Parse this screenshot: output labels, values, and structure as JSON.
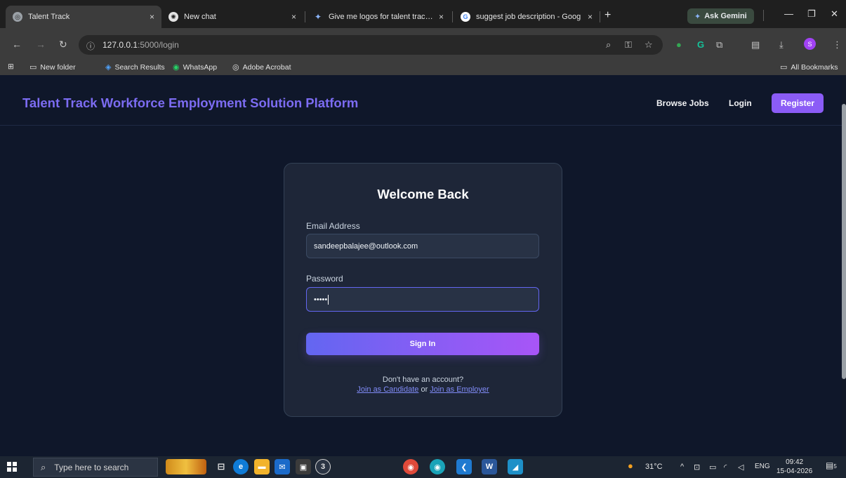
{
  "browser": {
    "tabs": [
      {
        "title": "Talent Track",
        "active": true,
        "close": "×"
      },
      {
        "title": "New chat",
        "active": false,
        "close": "×"
      },
      {
        "title": "Give me logos for talent track w",
        "active": false,
        "close": "×"
      },
      {
        "title": "suggest job description - Goog",
        "active": false,
        "close": "×"
      }
    ],
    "new_tab": "+",
    "gemini_label": "Ask Gemini",
    "window_controls": {
      "minimize": "—",
      "restore": "❐",
      "close": "✕"
    },
    "url_host": "127.0.0.1",
    "url_path": ":5000/login",
    "bookmarks": [
      {
        "label": "New folder",
        "icon": "folder-icon"
      },
      {
        "label": "Search Results",
        "icon": "search-results-icon"
      },
      {
        "label": "WhatsApp",
        "icon": "whatsapp-icon"
      },
      {
        "label": "Adobe Acrobat",
        "icon": "acrobat-icon"
      }
    ],
    "all_bookmarks": "All Bookmarks",
    "profile_initial": "S"
  },
  "page": {
    "brand": "Talent Track Workforce Employment Solution Platform",
    "nav": {
      "browse_jobs": "Browse Jobs",
      "login": "Login",
      "register": "Register"
    },
    "colors": {
      "brand": "#7c6cf2",
      "accent": "#8b5cf6",
      "background": "#0f172a",
      "card": "#1e2638"
    },
    "login_card": {
      "title": "Welcome Back",
      "email_label": "Email Address",
      "email_value": "sandeepbalajee@outlook.com",
      "password_label": "Password",
      "password_value": "•••••",
      "sign_in": "Sign In",
      "no_account": "Don't have an account?",
      "join_candidate": "Join as Candidate",
      "or": "or",
      "join_employer": "Join as Employer"
    }
  },
  "taskbar": {
    "search_placeholder": "Type here to search",
    "whatsapp_badge": "3",
    "temperature": "31°C",
    "language": "ENG",
    "time": "09:42",
    "date": "15-04-2026",
    "notification_count": "5"
  }
}
